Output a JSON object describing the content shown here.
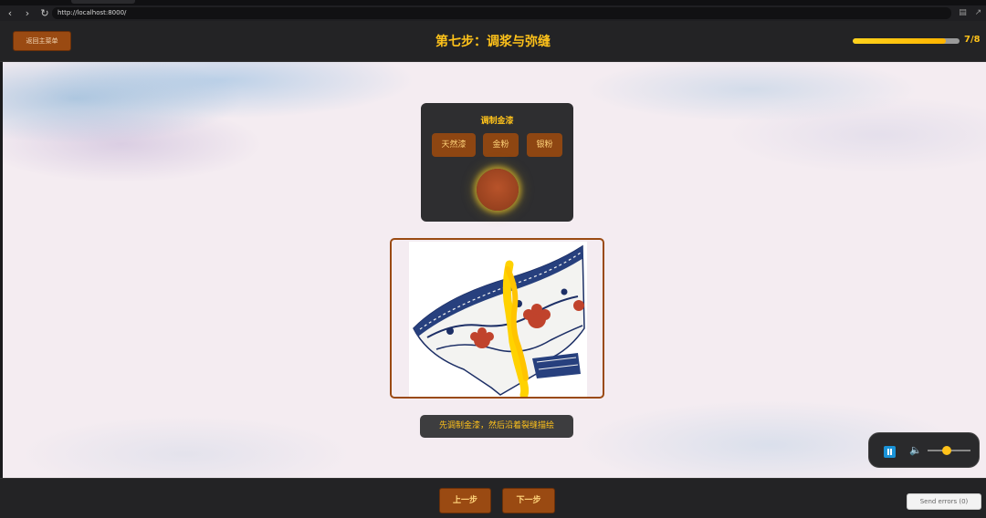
{
  "browser": {
    "url": "http://localhost:8000/",
    "back_icon": "chevron-left-icon",
    "forward_icon": "chevron-right-icon",
    "reload_icon": "reload-icon"
  },
  "header": {
    "back_label": "返回主菜单",
    "title": "第七步：调浆与弥缝",
    "progress_text": "7/8",
    "progress_fraction": 0.875
  },
  "mix_panel": {
    "title": "调制金漆",
    "ingredients": [
      "天然漆",
      "金粉",
      "银粉"
    ]
  },
  "hint": "先调制金漆，然后沿着裂缝描绘",
  "audio": {
    "state": "playing",
    "volume_fraction": 0.42
  },
  "footer": {
    "prev_label": "上一步",
    "next_label": "下一步",
    "send_errors_label": "Send errors (0)"
  },
  "colors": {
    "accent": "#ffc21a",
    "button_bg": "#9a4a12",
    "panel_bg": "#2e2e30",
    "audio_play": "#1a93d8"
  }
}
